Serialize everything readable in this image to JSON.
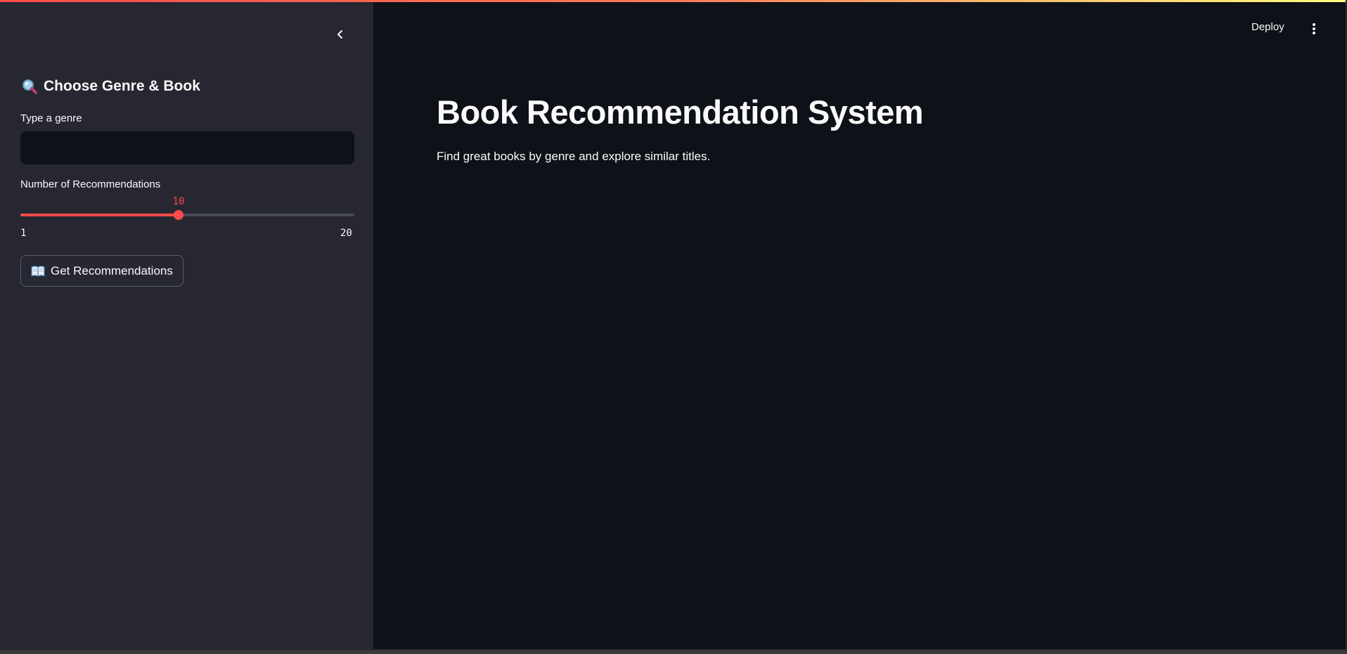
{
  "header": {
    "deploy_label": "Deploy",
    "menu_icon": "more-vertical-icon"
  },
  "sidebar": {
    "collapse_icon": "chevron-left-icon",
    "title_icon": "magnifier-emoji-icon",
    "title": "Choose Genre & Book",
    "genre_label": "Type a genre",
    "genre_value": "",
    "slider": {
      "label": "Number of Recommendations",
      "min": 1,
      "max": 20,
      "value": 10,
      "min_label": "1",
      "max_label": "20",
      "value_label": "10"
    },
    "button": {
      "icon": "open-book-emoji-icon",
      "label": "Get Recommendations"
    }
  },
  "main": {
    "title": "Book Recommendation System",
    "subtitle": "Find great books by genre and explore similar titles."
  },
  "colors": {
    "accent": "#ff4b4b",
    "background": "#0e1117",
    "sidebar": "#262730",
    "text": "#fafafa"
  }
}
